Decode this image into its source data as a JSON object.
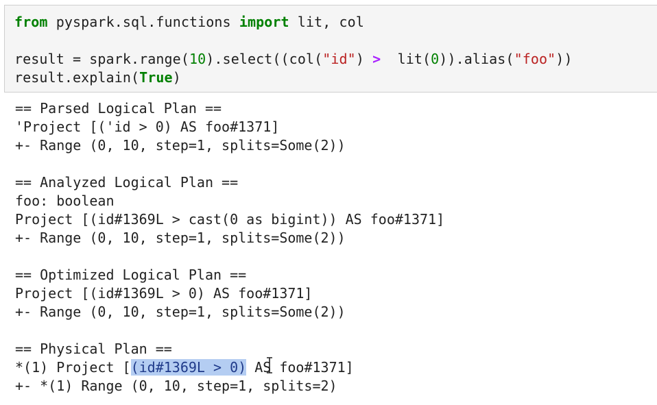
{
  "code": {
    "line1": {
      "kw1": "from",
      "module": " pyspark.sql.functions ",
      "kw2": "import",
      "rest": " lit, col"
    },
    "line2": {
      "a": "result = spark.range(",
      "n1": "10",
      "b": ").select((col(",
      "s1": "\"id\"",
      "c": ") ",
      "op": ">",
      "d": "  lit(",
      "n2": "0",
      "e": ")).alias(",
      "s2": "\"foo\"",
      "f": "))"
    },
    "line3": {
      "a": "result.explain(",
      "kw": "True",
      "b": ")"
    }
  },
  "output": {
    "l1": "== Parsed Logical Plan ==",
    "l2": "'Project [('id > 0) AS foo#1371]",
    "l3": "+- Range (0, 10, step=1, splits=Some(2))",
    "l4": "== Analyzed Logical Plan ==",
    "l5": "foo: boolean",
    "l6": "Project [(id#1369L > cast(0 as bigint)) AS foo#1371]",
    "l7": "+- Range (0, 10, step=1, splits=Some(2))",
    "l8": "== Optimized Logical Plan ==",
    "l9": "Project [(id#1369L > 0) AS foo#1371]",
    "l10": "+- Range (0, 10, step=1, splits=Some(2))",
    "l11": "== Physical Plan ==",
    "l12": {
      "pre": "*(1) Project [",
      "selected": "(id#1369L > 0)",
      "post": " AS foo#1371]"
    },
    "l13": "+- *(1) Range (0, 10, step=1, splits=2)"
  },
  "icons": {
    "cursor": "text-cursor-icon"
  },
  "colors": {
    "keyword": "#008000",
    "string": "#ba2121",
    "operator": "#aa22ff",
    "selection": "#b4cdf2"
  }
}
